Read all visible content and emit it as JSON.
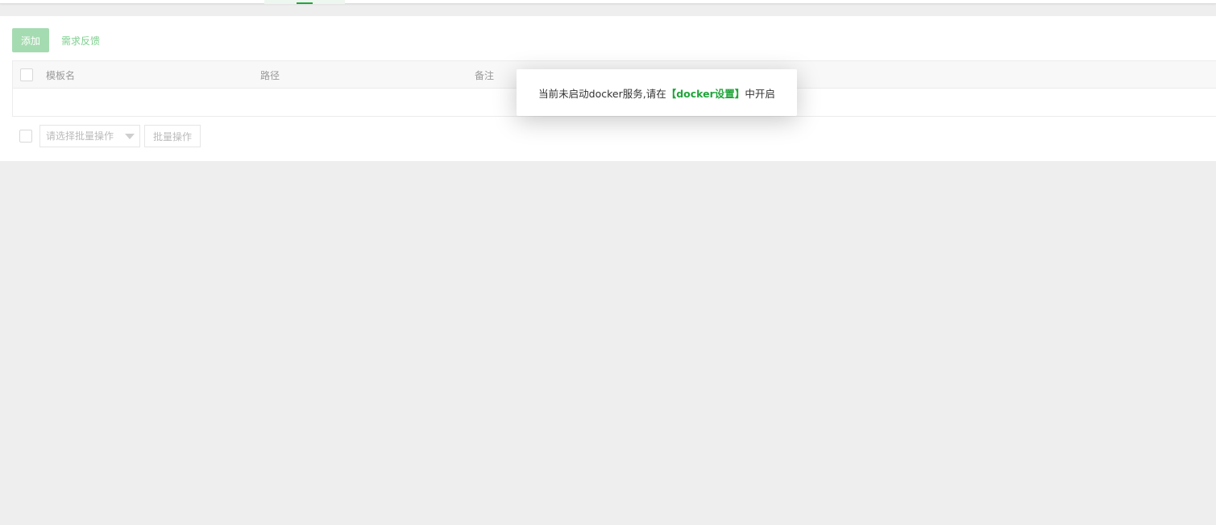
{
  "toolbar": {
    "add_label": "添加",
    "feedback_label": "需求反馈"
  },
  "table": {
    "columns": [
      "模板名",
      "路径",
      "备注"
    ],
    "rows": []
  },
  "batch": {
    "select_placeholder": "请选择批量操作",
    "button_label": "批量操作"
  },
  "toast": {
    "text_before": "当前未启动docker服务,请在",
    "link_text": "【docker设置】",
    "text_after": "中开启"
  },
  "colors": {
    "accent": "#20a53a",
    "disabled_button": "#a5dbb0",
    "background": "#eeeeee"
  }
}
